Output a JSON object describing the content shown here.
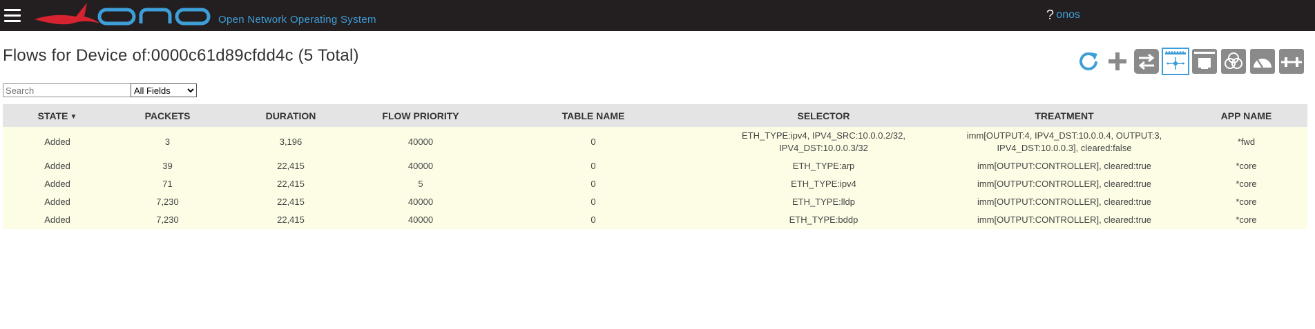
{
  "header": {
    "logo_text": "onos",
    "subtitle": "Open Network Operating System",
    "help": "?",
    "user": "onos"
  },
  "page": {
    "title": "Flows for Device of:0000c61d89cfdd4c (5 Total)"
  },
  "search": {
    "placeholder": "Search",
    "field_selected": "All Fields"
  },
  "toolbar": {
    "icons": [
      "refresh-icon",
      "add-icon",
      "switch-icon",
      "flows-icon",
      "ports-icon",
      "groups-icon",
      "meters-icon",
      "pipeconf-icon"
    ],
    "accent": "#3e9ed8",
    "icon_gray": "#8a8a8a"
  },
  "table": {
    "sort_column": "STATE",
    "headers": [
      "STATE",
      "PACKETS",
      "DURATION",
      "FLOW PRIORITY",
      "TABLE NAME",
      "SELECTOR",
      "TREATMENT",
      "APP NAME"
    ],
    "rows": [
      {
        "state": "Added",
        "packets": "3",
        "duration": "3,196",
        "priority": "40000",
        "table": "0",
        "selector_line1": "ETH_TYPE:ipv4, IPV4_SRC:10.0.0.2/32,",
        "selector_line2": "IPV4_DST:10.0.0.3/32",
        "treatment_line1": "imm[OUTPUT:4, IPV4_DST:10.0.0.4, OUTPUT:3,",
        "treatment_line2": "IPV4_DST:10.0.0.3], cleared:false",
        "app": "*fwd"
      },
      {
        "state": "Added",
        "packets": "39",
        "duration": "22,415",
        "priority": "40000",
        "table": "0",
        "selector": "ETH_TYPE:arp",
        "treatment": "imm[OUTPUT:CONTROLLER], cleared:true",
        "app": "*core"
      },
      {
        "state": "Added",
        "packets": "71",
        "duration": "22,415",
        "priority": "5",
        "table": "0",
        "selector": "ETH_TYPE:ipv4",
        "treatment": "imm[OUTPUT:CONTROLLER], cleared:true",
        "app": "*core"
      },
      {
        "state": "Added",
        "packets": "7,230",
        "duration": "22,415",
        "priority": "40000",
        "table": "0",
        "selector": "ETH_TYPE:lldp",
        "treatment": "imm[OUTPUT:CONTROLLER], cleared:true",
        "app": "*core"
      },
      {
        "state": "Added",
        "packets": "7,230",
        "duration": "22,415",
        "priority": "40000",
        "table": "0",
        "selector": "ETH_TYPE:bddp",
        "treatment": "imm[OUTPUT:CONTROLLER], cleared:true",
        "app": "*core"
      }
    ]
  }
}
